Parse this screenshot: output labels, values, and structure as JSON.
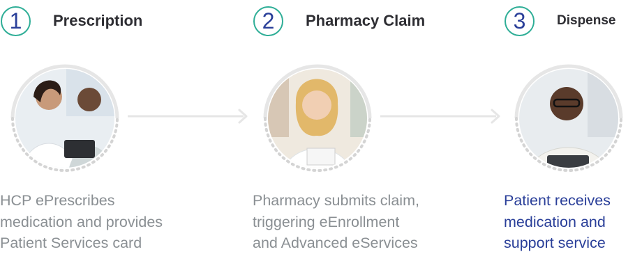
{
  "steps": [
    {
      "number": "1",
      "title": "Prescription",
      "description": [
        "HCP ePrescribes",
        "medication and provides",
        "Patient Services card"
      ]
    },
    {
      "number": "2",
      "title": "Pharmacy Claim",
      "description": [
        "Pharmacy submits claim,",
        "triggering eEnrollment",
        "and Advanced eServices"
      ]
    },
    {
      "number": "3",
      "title": "Dispense",
      "description": [
        "Patient receives",
        "medication and",
        "support service"
      ]
    }
  ],
  "colors": {
    "number_ring": "#2fae97",
    "number_text": "#2a3f99",
    "title_text": "#2e2e33",
    "body_text": "#8a8f93",
    "highlight_text": "#2a3f99",
    "connector": "#e6e6e6"
  }
}
